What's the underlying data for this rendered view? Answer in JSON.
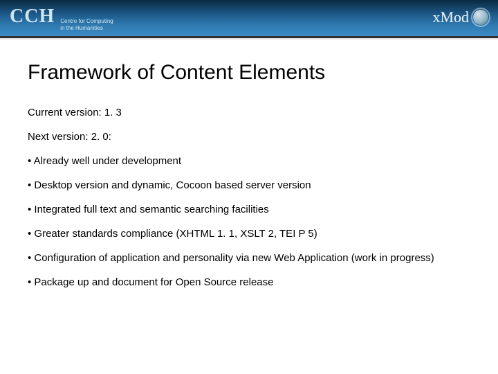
{
  "header": {
    "logo_left": {
      "mark": "CCH",
      "subtitle": "Centre for Computing\nin the Humanities"
    },
    "logo_right": {
      "text": "xMod"
    }
  },
  "title": "Framework of Content Elements",
  "lines": {
    "current": "Current version: 1. 3",
    "next": "Next version: 2. 0:"
  },
  "bullets": [
    "• Already well under development",
    "• Desktop version and dynamic, Cocoon based server version",
    "• Integrated full text and semantic searching facilities",
    "• Greater standards compliance (XHTML 1. 1, XSLT 2, TEI P 5)",
    "• Configuration of application and personality via new Web Application (work in progress)",
    "• Package up and document for Open Source release"
  ]
}
